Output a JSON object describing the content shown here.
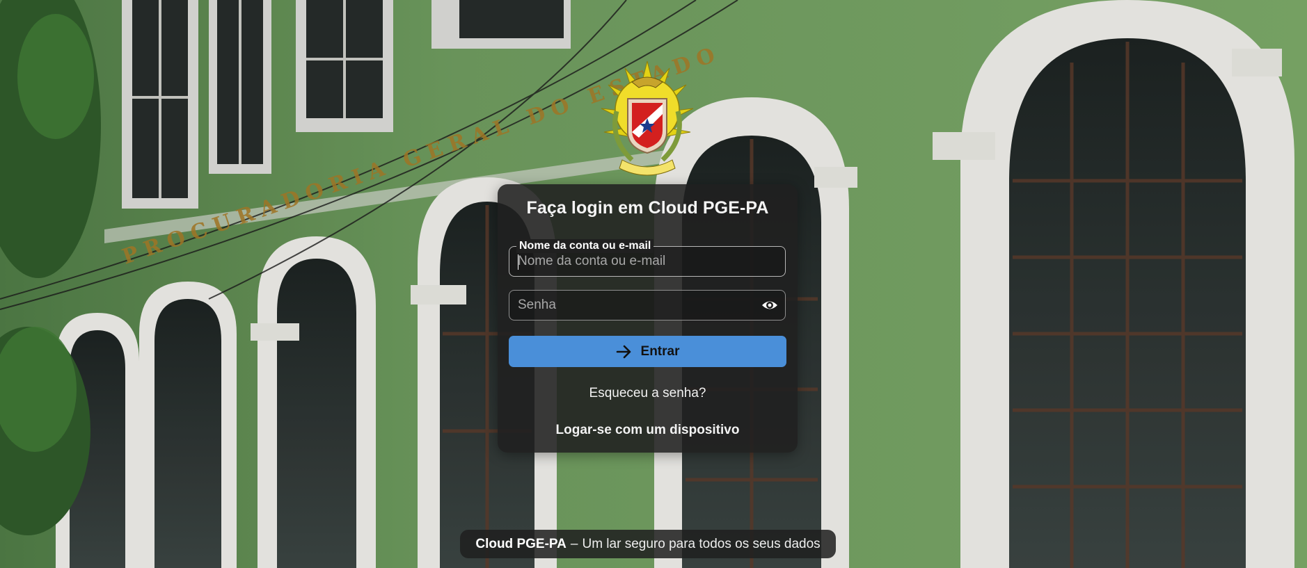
{
  "login": {
    "title": "Faça login em Cloud PGE-PA",
    "username": {
      "label": "Nome da conta ou e-mail",
      "placeholder": "Nome da conta ou e-mail",
      "value": ""
    },
    "password": {
      "placeholder": "Senha",
      "value": ""
    },
    "submit_label": "Entrar",
    "forgot_password": "Esqueceu a senha?",
    "device_login": "Logar-se com um dispositivo"
  },
  "footer": {
    "brand": "Cloud PGE-PA",
    "separator": "–",
    "tagline": "Um lar seguro para todos os seus dados"
  },
  "background": {
    "facade_lettering": "PROCURADORIA GERAL DO ESTADO"
  },
  "icons": {
    "logo": "para-state-coat-of-arms",
    "password_toggle": "eye-icon",
    "submit": "arrow-right-icon"
  },
  "colors": {
    "primary_button": "#4a8fd9",
    "card_background": "#202020",
    "facade_green": "#6f9a5f"
  }
}
